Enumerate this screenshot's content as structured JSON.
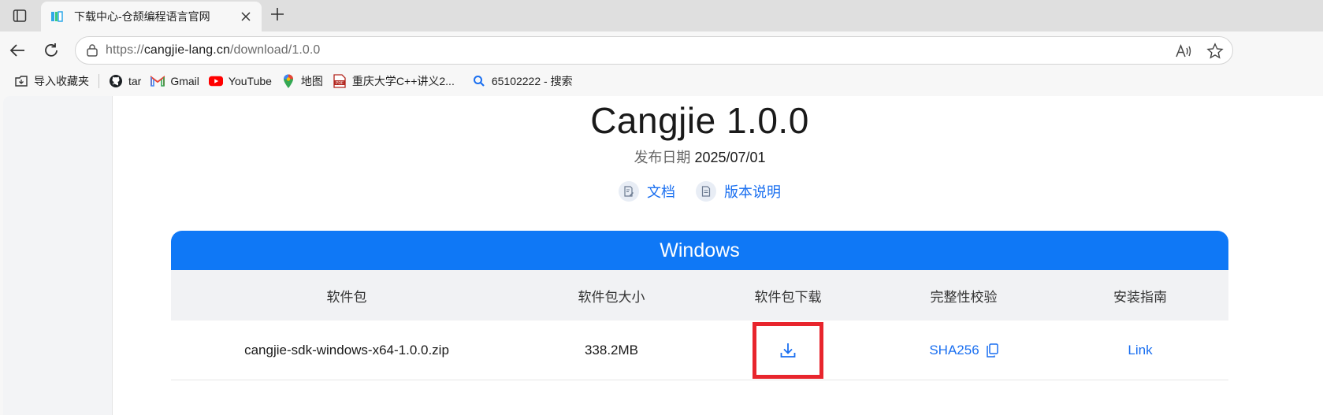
{
  "browser": {
    "tab": {
      "title": "下载中心-仓颉编程语言官网"
    },
    "address": {
      "scheme": "https://",
      "host": "cangjie-lang.cn",
      "path": "/download/1.0.0"
    },
    "bookmarks": [
      {
        "label": "导入收藏夹",
        "icon": "import-favorites-icon"
      },
      {
        "label": "tar",
        "icon": "github-icon"
      },
      {
        "label": "Gmail",
        "icon": "gmail-icon"
      },
      {
        "label": "YouTube",
        "icon": "youtube-icon"
      },
      {
        "label": "地图",
        "icon": "maps-icon"
      },
      {
        "label": "重庆大学C++讲义2...",
        "icon": "pdf-icon"
      },
      {
        "label": "65102222 - 搜索",
        "icon": "search-icon"
      }
    ]
  },
  "page": {
    "title": "Cangjie 1.0.0",
    "release_label": "发布日期",
    "release_date": "2025/07/01",
    "links": {
      "docs": "文档",
      "release_notes": "版本说明"
    },
    "platform": "Windows",
    "table": {
      "headers": [
        "软件包",
        "软件包大小",
        "软件包下载",
        "完整性校验",
        "安装指南"
      ],
      "row": {
        "package": "cangjie-sdk-windows-x64-1.0.0.zip",
        "size": "338.2MB",
        "checksum": "SHA256",
        "guide": "Link"
      }
    }
  },
  "colors": {
    "accent": "#0f78f6",
    "link": "#1a6ff0",
    "highlight": "#e8252d"
  }
}
